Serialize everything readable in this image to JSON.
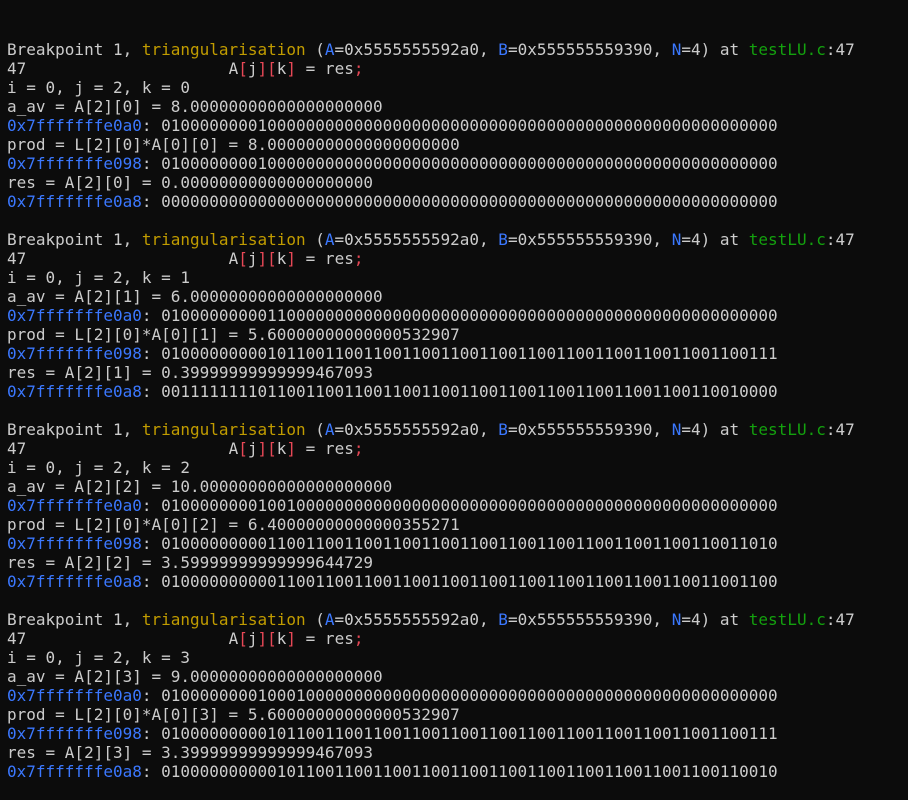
{
  "colors": {
    "background": "#0c0c0c",
    "text": "#cccccc",
    "function": "#c19c00",
    "argument": "#3b78ff",
    "file": "#13a10e",
    "address": "#3b78ff",
    "punct": "#e74856"
  },
  "blocks": [
    {
      "bp_prefix": "Breakpoint 1, ",
      "bp_func": "triangularisation",
      "bp_open": " (",
      "arg1_name": "A",
      "arg1_val": "=0x5555555592a0, ",
      "arg2_name": "B",
      "arg2_val": "=0x555555559390, ",
      "arg3_name": "N",
      "arg3_val": "=4) at ",
      "bp_file": "testLU.c",
      "bp_line": ":47",
      "src_lineno": "47",
      "src_indent": "                     ",
      "src_A": "A",
      "src_lb1": "[",
      "src_j": "j",
      "src_rb1": "][",
      "src_k": "k",
      "src_rb2": "]",
      "src_rest": " = res",
      "src_semi": ";",
      "ijk": "i = 0, j = 2, k = 0",
      "a_av": "a_av = A[2][0] = 8.00000000000000000000",
      "addr1": "0x7fffffffe0a0",
      "bits1": ": 0100000000100000000000000000000000000000000000000000000000000000",
      "prod": "prod = L[2][0]*A[0][0] = 8.00000000000000000000",
      "addr2": "0x7fffffffe098",
      "bits2": ": 0100000000100000000000000000000000000000000000000000000000000000",
      "res": "res = A[2][0] = 0.00000000000000000000",
      "addr3": "0x7fffffffe0a8",
      "bits3": ": 0000000000000000000000000000000000000000000000000000000000000000"
    },
    {
      "bp_prefix": "Breakpoint 1, ",
      "bp_func": "triangularisation",
      "bp_open": " (",
      "arg1_name": "A",
      "arg1_val": "=0x5555555592a0, ",
      "arg2_name": "B",
      "arg2_val": "=0x555555559390, ",
      "arg3_name": "N",
      "arg3_val": "=4) at ",
      "bp_file": "testLU.c",
      "bp_line": ":47",
      "src_lineno": "47",
      "src_indent": "                     ",
      "src_A": "A",
      "src_lb1": "[",
      "src_j": "j",
      "src_rb1": "][",
      "src_k": "k",
      "src_rb2": "]",
      "src_rest": " = res",
      "src_semi": ";",
      "ijk": "i = 0, j = 2, k = 1",
      "a_av": "a_av = A[2][1] = 6.00000000000000000000",
      "addr1": "0x7fffffffe0a0",
      "bits1": ": 0100000000011000000000000000000000000000000000000000000000000000",
      "prod": "prod = L[2][0]*A[0][1] = 5.60000000000000532907",
      "addr2": "0x7fffffffe098",
      "bits2": ": 0100000000010110011001100110011001100110011001100110011001100111",
      "res": "res = A[2][1] = 0.39999999999999467093",
      "addr3": "0x7fffffffe0a8",
      "bits3": ": 0011111111011001100110011001100110011001100110011001100110010000"
    },
    {
      "bp_prefix": "Breakpoint 1, ",
      "bp_func": "triangularisation",
      "bp_open": " (",
      "arg1_name": "A",
      "arg1_val": "=0x5555555592a0, ",
      "arg2_name": "B",
      "arg2_val": "=0x555555559390, ",
      "arg3_name": "N",
      "arg3_val": "=4) at ",
      "bp_file": "testLU.c",
      "bp_line": ":47",
      "src_lineno": "47",
      "src_indent": "                     ",
      "src_A": "A",
      "src_lb1": "[",
      "src_j": "j",
      "src_rb1": "][",
      "src_k": "k",
      "src_rb2": "]",
      "src_rest": " = res",
      "src_semi": ";",
      "ijk": "i = 0, j = 2, k = 2",
      "a_av": "a_av = A[2][2] = 10.00000000000000000000",
      "addr1": "0x7fffffffe0a0",
      "bits1": ": 0100000000100100000000000000000000000000000000000000000000000000",
      "prod": "prod = L[2][0]*A[0][2] = 6.40000000000000355271",
      "addr2": "0x7fffffffe098",
      "bits2": ": 0100000000011001100110011001100110011001100110011001100110011010",
      "res": "res = A[2][2] = 3.59999999999999644729",
      "addr3": "0x7fffffffe0a8",
      "bits3": ": 0100000000001100110011001100110011001100110011001100110011001100"
    },
    {
      "bp_prefix": "Breakpoint 1, ",
      "bp_func": "triangularisation",
      "bp_open": " (",
      "arg1_name": "A",
      "arg1_val": "=0x5555555592a0, ",
      "arg2_name": "B",
      "arg2_val": "=0x555555559390, ",
      "arg3_name": "N",
      "arg3_val": "=4) at ",
      "bp_file": "testLU.c",
      "bp_line": ":47",
      "src_lineno": "47",
      "src_indent": "                     ",
      "src_A": "A",
      "src_lb1": "[",
      "src_j": "j",
      "src_rb1": "][",
      "src_k": "k",
      "src_rb2": "]",
      "src_rest": " = res",
      "src_semi": ";",
      "ijk": "i = 0, j = 2, k = 3",
      "a_av": "a_av = A[2][3] = 9.00000000000000000000",
      "addr1": "0x7fffffffe0a0",
      "bits1": ": 0100000000100010000000000000000000000000000000000000000000000000",
      "prod": "prod = L[2][0]*A[0][3] = 5.60000000000000532907",
      "addr2": "0x7fffffffe098",
      "bits2": ": 0100000000010110011001100110011001100110011001100110011001100111",
      "res": "res = A[2][3] = 3.39999999999999467093",
      "addr3": "0x7fffffffe0a8",
      "bits3": ": 0100000000001011001100110011001100110011001100110011001100110010"
    }
  ]
}
